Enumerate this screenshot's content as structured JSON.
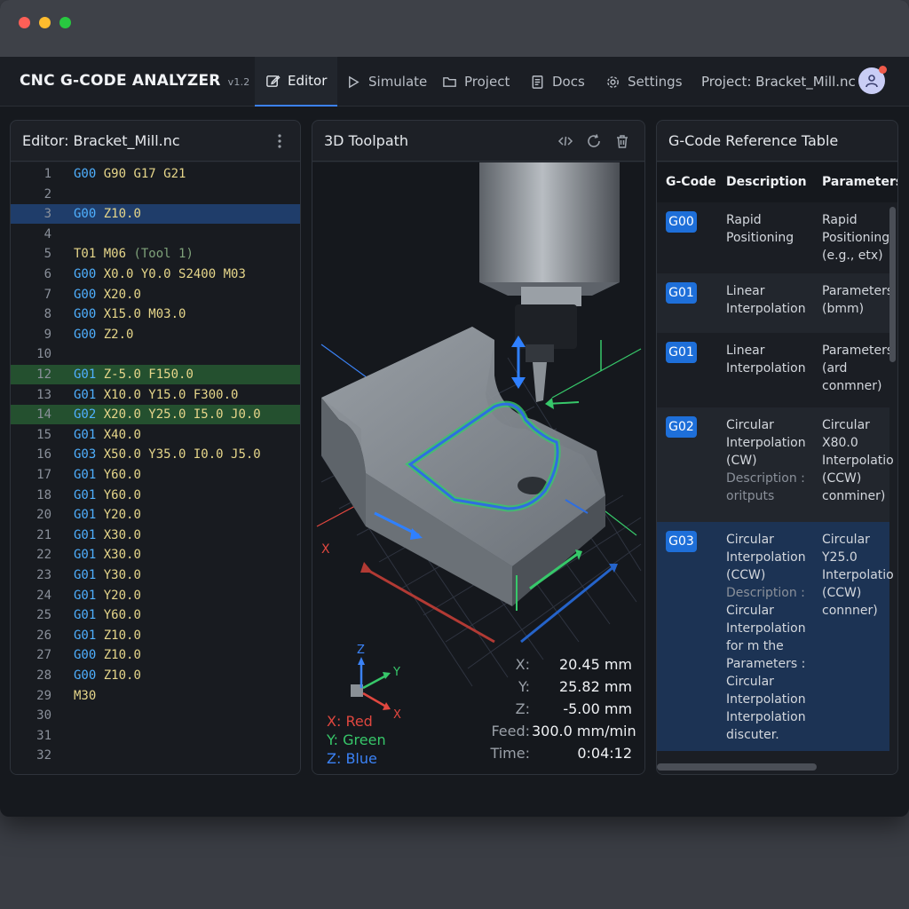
{
  "app": {
    "title": "CNC G-CODE ANALYZER",
    "version": "v1.2",
    "project_label": "Project: Bracket_Mill.nc"
  },
  "nav": {
    "editor": "Editor",
    "simulate": "Simulate",
    "project": "Project",
    "docs": "Docs",
    "settings": "Settings"
  },
  "editor": {
    "title": "Editor: Bracket_Mill.nc",
    "lines": [
      {
        "n": "1",
        "code": "G00",
        "rest": " G90 G17 G21",
        "hl": ""
      },
      {
        "n": "2",
        "code": "",
        "rest": "",
        "hl": ""
      },
      {
        "n": "3",
        "code": "G00",
        "rest": " Z10.0",
        "hl": "blue"
      },
      {
        "n": "4",
        "code": "",
        "rest": "",
        "hl": ""
      },
      {
        "n": "5",
        "code": "",
        "rest": "T01 M06 ",
        "comment": "(Tool 1)",
        "hl": ""
      },
      {
        "n": "6",
        "code": "G00",
        "rest": " X0.0 Y0.0 S2400 M03",
        "hl": ""
      },
      {
        "n": "7",
        "code": "G00",
        "rest": " X20.0",
        "hl": ""
      },
      {
        "n": "8",
        "code": "G00",
        "rest": " X15.0 M03.0",
        "hl": ""
      },
      {
        "n": "9",
        "code": "G00",
        "rest": " Z2.0",
        "hl": ""
      },
      {
        "n": "10",
        "code": "",
        "rest": "",
        "hl": ""
      },
      {
        "n": "12",
        "code": "G01",
        "rest": " Z-5.0 F150.0",
        "hl": "green"
      },
      {
        "n": "13",
        "code": "G01",
        "rest": " X10.0 Y15.0 F300.0",
        "hl": ""
      },
      {
        "n": "14",
        "code": "G02",
        "rest": " X20.0 Y25.0 I5.0 J0.0",
        "hl": "green"
      },
      {
        "n": "15",
        "code": "G01",
        "rest": " X40.0",
        "hl": ""
      },
      {
        "n": "16",
        "code": "G03",
        "rest": " X50.0 Y35.0 I0.0 J5.0",
        "hl": ""
      },
      {
        "n": "17",
        "code": "G01",
        "rest": " Y60.0",
        "hl": ""
      },
      {
        "n": "18",
        "code": "G01",
        "rest": " Y60.0",
        "hl": ""
      },
      {
        "n": "20",
        "code": "G01",
        "rest": " Y20.0",
        "hl": ""
      },
      {
        "n": "21",
        "code": "G01",
        "rest": " X30.0",
        "hl": ""
      },
      {
        "n": "22",
        "code": "G01",
        "rest": " X30.0",
        "hl": ""
      },
      {
        "n": "23",
        "code": "G01",
        "rest": " Y30.0",
        "hl": ""
      },
      {
        "n": "24",
        "code": "G01",
        "rest": " Y20.0",
        "hl": ""
      },
      {
        "n": "25",
        "code": "G01",
        "rest": " Y60.0",
        "hl": ""
      },
      {
        "n": "26",
        "code": "G01",
        "rest": " Z10.0",
        "hl": ""
      },
      {
        "n": "27",
        "code": "G00",
        "rest": " Z10.0",
        "hl": ""
      },
      {
        "n": "28",
        "code": "G00",
        "rest": " Z10.0",
        "hl": ""
      },
      {
        "n": "29",
        "code": "",
        "rest": "M30",
        "hl": ""
      },
      {
        "n": "30",
        "code": "",
        "rest": "",
        "hl": ""
      },
      {
        "n": "31",
        "code": "",
        "rest": "",
        "hl": ""
      },
      {
        "n": "32",
        "code": "",
        "rest": "",
        "hl": ""
      }
    ]
  },
  "viewport": {
    "title": "3D Toolpath",
    "axes": {
      "x": "X",
      "y": "Y",
      "z": "Z"
    },
    "legend": {
      "x": "X: Red",
      "y": "Y: Green",
      "z": "Z: Blue"
    },
    "readout": {
      "x_label": "X:",
      "x_value": "20.45 mm",
      "y_label": "Y:",
      "y_value": "25.82 mm",
      "z_label": "Z:",
      "z_value": "-5.00 mm",
      "feed_label": "Feed:",
      "feed_value": "300.0 mm/min",
      "time_label": "Time:",
      "time_value": "0:04:12"
    },
    "colors": {
      "x": "#e0473f",
      "y": "#37c86a",
      "z": "#3b82f6"
    }
  },
  "reference": {
    "title": "G-Code Reference Table",
    "headers": {
      "code": "G-Code",
      "desc": "Description",
      "params": "Parameters"
    },
    "rows": [
      {
        "code": "G00",
        "desc": [
          "Rapid",
          "Positioning"
        ],
        "params": [
          "Rapid",
          "Positioning",
          "(e.g., etx)"
        ]
      },
      {
        "code": "G01",
        "desc": [
          "Linear",
          "Interpolation"
        ],
        "params": [
          "Parameters",
          "(bmm)"
        ]
      },
      {
        "code": "G01",
        "desc": [
          "Linear",
          "Interpolation"
        ],
        "params": [
          "Parameters",
          "(ard",
          "conmner)"
        ]
      },
      {
        "code": "G02",
        "desc": [
          "Circular",
          "Interpolation",
          "(CW)",
          "Description :",
          "oritputs"
        ],
        "params": [
          "Circular",
          "X80.0",
          "Interpolation",
          "(CCW)",
          "conminer)"
        ]
      },
      {
        "code": "G03",
        "desc": [
          "Circular",
          "Interpolation",
          "(CCW)",
          "Description :",
          "Circular",
          "Interpolation",
          "for m the",
          "Parameters :",
          "Circular",
          "Interpolation",
          "Interpolation",
          "discuter."
        ],
        "params": [
          "Circular",
          "Y25.0",
          "Interpolation",
          "(CCW)",
          "connner)"
        ]
      }
    ]
  }
}
